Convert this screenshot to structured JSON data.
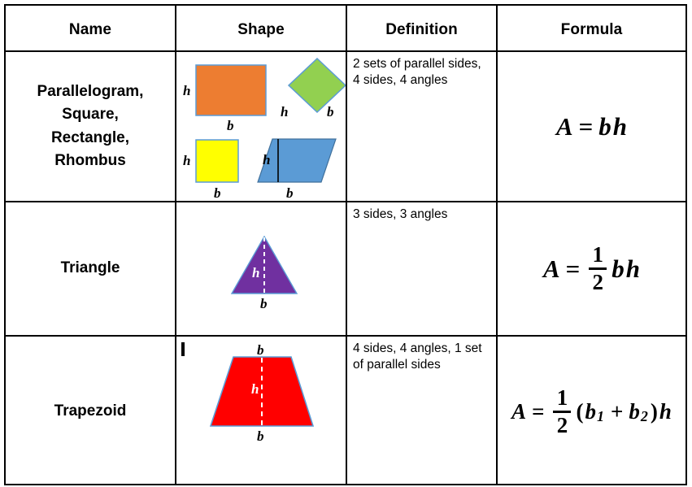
{
  "table": {
    "headers": [
      "Name",
      "Shape",
      "Definition",
      "Formula"
    ],
    "rows": [
      {
        "name": "Parallelogram,\nSquare,\nRectangle,\nRhombus",
        "name_lines": [
          "Parallelogram,",
          "Square,",
          "Rectangle,",
          "Rhombus"
        ],
        "definition": "2 sets of parallel sides, 4 sides, 4 angles",
        "formula_text": "A = bh",
        "formula_parts": {
          "area": "A",
          "equals": "=",
          "base": "b",
          "height": "h"
        },
        "shapes": [
          {
            "id": "rectangle",
            "fill": "#ED7D31",
            "stroke": "#5B9BD5",
            "labels": [
              "h",
              "b"
            ]
          },
          {
            "id": "rhombus-diamond",
            "fill": "#92D050",
            "stroke": "#5B9BD5",
            "labels": [
              "h",
              "b"
            ]
          },
          {
            "id": "square",
            "fill": "#FFFF00",
            "stroke": "#5B9BD5",
            "labels": [
              "h",
              "b"
            ]
          },
          {
            "id": "parallelogram",
            "fill": "#5B9BD5",
            "stroke": "#41719C",
            "labels": [
              "h",
              "b"
            ]
          }
        ]
      },
      {
        "name": "Triangle",
        "name_lines": [
          "Triangle"
        ],
        "definition": "3 sides, 3 angles",
        "formula_text": "A = 1/2 bh",
        "formula_parts": {
          "area": "A",
          "equals": "=",
          "numerator": "1",
          "denominator": "2",
          "base": "b",
          "height": "h"
        },
        "shapes": [
          {
            "id": "triangle",
            "fill": "#7030A0",
            "stroke": "#5B9BD5",
            "labels": [
              "h",
              "b"
            ]
          }
        ]
      },
      {
        "name": "Trapezoid",
        "name_lines": [
          "Trapezoid"
        ],
        "definition": "4 sides, 4 angles, 1 set of parallel sides",
        "formula_text": "A = 1/2 (b₁ + b₂)h",
        "formula_parts": {
          "area": "A",
          "equals": "=",
          "numerator": "1",
          "denominator": "2",
          "open_paren": "(",
          "base1": "b",
          "base1_sub": "1",
          "plus": "+",
          "base2": "b",
          "base2_sub": "2",
          "close_paren": ")",
          "height": "h"
        },
        "shapes": [
          {
            "id": "trapezoid",
            "fill": "#FF0000",
            "stroke": "#5B9BD5",
            "labels": [
              "b",
              "h",
              "b"
            ]
          }
        ]
      }
    ]
  },
  "labels": {
    "h": "h",
    "b": "b"
  },
  "colors": {
    "orange": "#ED7D31",
    "green": "#92D050",
    "yellow": "#FFFF00",
    "blue": "#5B9BD5",
    "purple": "#7030A0",
    "red": "#FF0000",
    "border": "#000000",
    "shape_outline": "#5B9BD5"
  }
}
